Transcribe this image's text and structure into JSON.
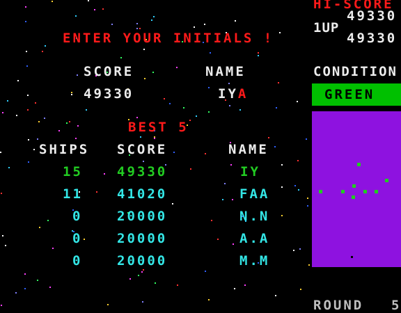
{
  "colors": {
    "red": "#ff1a1a",
    "white": "#ececec",
    "cyan": "#33e6e6",
    "green": "#22cc22",
    "radar_bg": "#8e12e0",
    "condition_green": "#00c000"
  },
  "header": {
    "prompt": "ENTER YOUR INITIALS !"
  },
  "entry": {
    "score_label": "SCORE",
    "name_label": "NAME",
    "score_value": "49330",
    "name_fixed": "IY",
    "name_cursor": "A"
  },
  "best": {
    "title": "BEST 5",
    "col_ships": "SHIPS",
    "col_score": "SCORE",
    "col_name": "NAME",
    "rows": [
      {
        "ships": "15",
        "score": "49330",
        "name": "IY",
        "highlight": true
      },
      {
        "ships": "11",
        "score": "41020",
        "name": "FAA",
        "highlight": false
      },
      {
        "ships": "0",
        "score": "20000",
        "name": "N.N",
        "highlight": false
      },
      {
        "ships": "0",
        "score": "20000",
        "name": "A.A",
        "highlight": false
      },
      {
        "ships": "0",
        "score": "20000",
        "name": "M.M",
        "highlight": false
      }
    ]
  },
  "side": {
    "hi_score_label": "HI-SCORE",
    "hi_score_value": "49330",
    "player_label": "1UP",
    "player_score": "49330",
    "condition_label": "CONDITION",
    "condition_value": "GREEN",
    "round_label": "ROUND",
    "round_value": "5"
  }
}
